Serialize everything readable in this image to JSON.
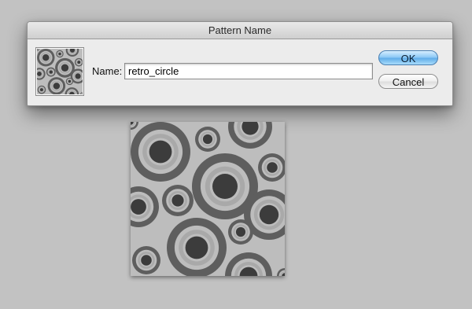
{
  "dialog": {
    "title": "Pattern Name",
    "name_label": "Name:",
    "name_value": "retro_circle",
    "ok_label": "OK",
    "cancel_label": "Cancel"
  },
  "pattern": {
    "colors": {
      "background": "#bdbdbd",
      "dark": "#5e5e5e",
      "light": "#a9a9a9",
      "center": "#3c3c3c"
    }
  }
}
